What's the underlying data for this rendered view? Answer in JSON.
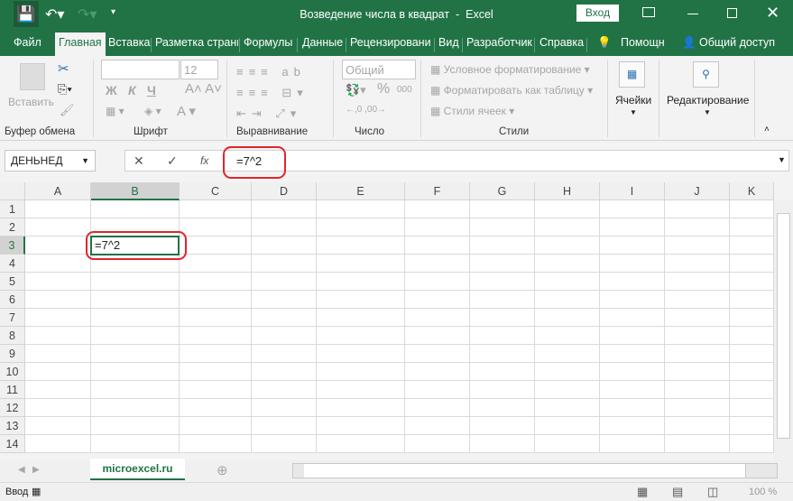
{
  "title_bar": {
    "title": "Возведение числа в квадрат  -  Excel",
    "signin": "Вход",
    "icons": [
      "save-icon",
      "undo-icon",
      "redo-icon",
      "customize-icon",
      "ribbon-display-icon",
      "minimize-icon",
      "maximize-icon",
      "close-icon"
    ]
  },
  "tabs": [
    "Файл",
    "Главная",
    "Вставка",
    "Разметка страни",
    "Формулы",
    "Данные",
    "Рецензировани",
    "Вид",
    "Разработчик",
    "Справка"
  ],
  "tell_me": "Помощн",
  "share": "Общий доступ",
  "ribbon": {
    "clipboard": {
      "paste": "Вставить",
      "label": "Буфер обмена"
    },
    "font": {
      "name": "",
      "size": "12",
      "bold": "Ж",
      "italic": "К",
      "underline": "Ч",
      "label": "Шрифт"
    },
    "alignment": {
      "label": "Выравнивание"
    },
    "number": {
      "format": "Общий",
      "percent": "%",
      "thousands": "000",
      "label": "Число"
    },
    "styles": {
      "conditional": "Условное форматирование",
      "as_table": "Форматировать как таблицу",
      "cell_styles": "Стили ячеек",
      "label": "Стили"
    },
    "cells": {
      "label": "Ячейки"
    },
    "editing": {
      "label": "Редактирование"
    }
  },
  "formula_bar": {
    "name_box": "ДЕНЬНЕД",
    "fx": "fx",
    "formula": "=7^2"
  },
  "grid": {
    "columns": [
      "A",
      "B",
      "C",
      "D",
      "E",
      "F",
      "G",
      "H",
      "I",
      "J",
      "K"
    ],
    "rows": [
      "1",
      "2",
      "3",
      "4",
      "5",
      "6",
      "7",
      "8",
      "9",
      "10",
      "11",
      "12",
      "13",
      "14"
    ],
    "active_cell": "B3",
    "active_value": "=7^2"
  },
  "sheet_tab": "microexcel.ru",
  "status": {
    "mode": "Ввод",
    "zoom": "100 %"
  },
  "colors": {
    "accent": "#217346",
    "highlight": "#e0262b"
  }
}
